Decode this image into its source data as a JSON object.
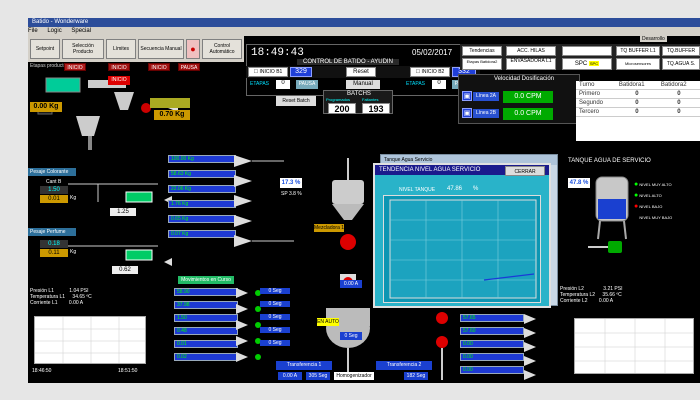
{
  "window": {
    "title": "Batido - Wonderware"
  },
  "menu": [
    "File",
    "Logic",
    "Special"
  ],
  "toolbar": {
    "setpoint": "Setpoint",
    "seleccion": "Selección Producto",
    "limites": "Límites",
    "secuencia": "Secuencia Manual",
    "control": "Control Automático",
    "etapas": "Etapas producto"
  },
  "pills": [
    "INICIO",
    "INICIO",
    "INICIO",
    "PAUSA"
  ],
  "header": {
    "time": "18:49:43",
    "date": "05/02/2017",
    "title": "CONTROL DE BATIDO - AYUDIN",
    "inicio_b1": "INICIO B1",
    "inicio_b1_val": "329",
    "reset": "Reset",
    "inicio_b2": "INICIO B2",
    "inicio_b2_val": "332",
    "etapas_left": "ETAPAS",
    "etapas_left_val": "0",
    "pausa": "PAUSA",
    "manual": "Manual",
    "etapas_right": "ETAPAS",
    "etapas_right_val": "0",
    "batchs_label": "BATCHS",
    "batchs_prog": "Programados",
    "batchs_falt": "Faltantes",
    "batchs_prog_val": "200",
    "batchs_falt_val": "193",
    "reset_batch": "Reset Batch"
  },
  "topright": {
    "tendencias": "Tendencias",
    "acc_hilas": "ACC. HILAS",
    "tq_buffer_l1": "TQ BUFFER L1",
    "tq_buffer_l2": "TQ.BUFFER",
    "etapas_batidora": "Etapas Batidora2",
    "envasadora": "ENVASADORA L1",
    "spc": "SPC",
    "microsensores": "Microsensores",
    "tq_agua": "TQ.AGUA S.",
    "desarrollo": "Desarrollo"
  },
  "velocidad": {
    "title": "Velocidad Dosificación",
    "linea1": "Línea 2A",
    "linea1_val": "0.0 CPM",
    "linea2": "Línea 2B",
    "linea2_val": "0.0 CPM"
  },
  "turno_table": {
    "headers": [
      "Turno",
      "Batidora1",
      "Batidora2"
    ],
    "rows": [
      {
        "label": "Primero",
        "b1": "0",
        "b2": "0"
      },
      {
        "label": "Segundo",
        "b1": "0",
        "b2": "0"
      },
      {
        "label": "Tercero",
        "b1": "0",
        "b2": "0"
      }
    ]
  },
  "tanque_agua": {
    "title": "TANQUE AGUA DE SERVICIO",
    "level": "47.8 %",
    "labels": [
      "NIVEL MUY ALTO",
      "NIVEL ALTO",
      "NIVEL BAJO",
      "NIVEL MUY BAJO"
    ]
  },
  "left": {
    "weight_right": "0.70 Kg",
    "weight_left": "0.00 Kg",
    "pesaje_colorante": "Pesaje Colorante",
    "cant_label": "Cant B",
    "cant_val1": "1.50",
    "cant_val2": "0.01",
    "cant_unit": "Kg",
    "colorante_val": "1.25",
    "pesaje_perfume": "Pesaje Perfume",
    "perfume_val1": "0.18",
    "perfume_val2": "0.11",
    "perfume_unit": "Kg",
    "perfume_val3": "0.62"
  },
  "center": {
    "tags_top": [
      "100.00 Kg",
      "58.63 Kg",
      "22.06 Kg",
      "1.76 Kg",
      "0.65 Kg",
      "0.07 Kg"
    ],
    "pct_left": "17.3 %",
    "sp_left": "SP 3.8 %",
    "label_mezcladora": "Mezcladora 1",
    "movimientos": "Movimientos en Curso",
    "en_auto": "EN AUTO",
    "motor_val": "0.00 A",
    "time_val": "0 Seg",
    "transferencia1": "Transferencia 1",
    "transferencia2": "Transferencia 2",
    "homogenizador": "Homogenizador",
    "transf_val1": "0.00 A",
    "transf_val2": "305 Seg",
    "transf_val3": "182 Seg",
    "sec_values": [
      "0 Seg",
      "0 Seg",
      "0 Seg",
      "0 Seg",
      "0 Seg"
    ],
    "bottom_tags": [
      "58.90",
      "37.98",
      "1.50",
      "0.48",
      "0.01",
      "0.02"
    ],
    "bottom_tags2": [
      "57.65",
      "57.60",
      "0.00",
      "0.00",
      "0.00"
    ]
  },
  "tanque_panel": {
    "window_title": "Tanque Agua Servicio"
  },
  "popup": {
    "title": "TENDENCIA NIVEL AGUA SERVICIO",
    "close": "CERRAR",
    "nivel_label": "NIVEL TANQUE",
    "nivel_val": "47.86",
    "nivel_unit": "%"
  },
  "bottom_left": {
    "presion": "Presión L1",
    "presion_val": "1.04",
    "presion_unit": "PSI",
    "temp": "Temperatura L1",
    "temp_val": "34.65",
    "temp_unit": "ºC",
    "corriente": "Corriente L1",
    "corriente_val": "0.00",
    "corriente_unit": "A",
    "time_axis": [
      "18:46:50",
      "18:51:50"
    ]
  },
  "bottom_right": {
    "presion": "Presión L2",
    "presion_val": "3.21",
    "presion_unit": "PSI",
    "temp": "Temperatura L2",
    "temp_val": "35.66",
    "temp_unit": "ºC",
    "corriente": "Corriente L2",
    "corriente_val": "0.00",
    "corriente_unit": "A"
  },
  "colors": {
    "screen_bg": "#000000",
    "blue_tag": "#1e3ad4",
    "cyan_popup": "#29b3c9",
    "green_status": "#00cc00",
    "red_status": "#d01010"
  }
}
